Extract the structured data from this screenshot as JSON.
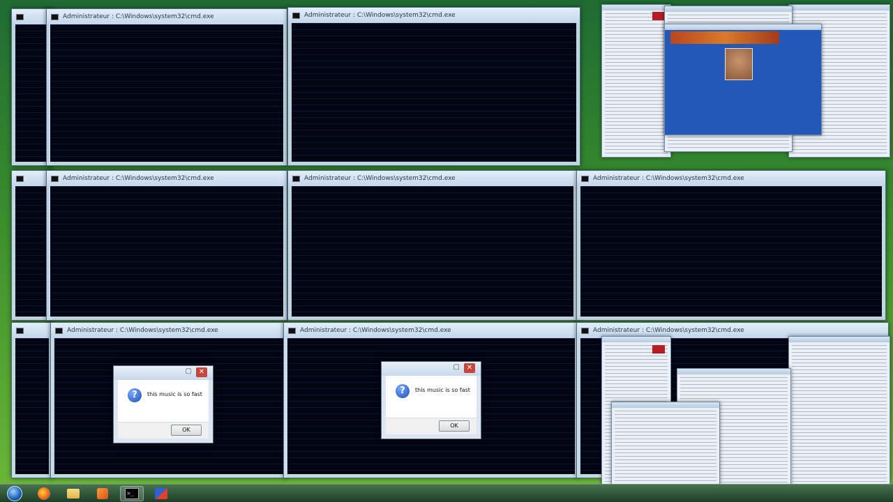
{
  "cmd_title": "Administrateur : C:\\Windows\\system32\\cmd.exe",
  "cmd_icon": "cmd-icon",
  "dialog": {
    "message": "this music is so fast",
    "ok_label": "OK",
    "icon": "question-icon"
  },
  "taskbar": {
    "items": [
      "start-orb-icon",
      "firefox-icon",
      "explorer-folder-icon",
      "media-player-icon",
      "cmd-icon",
      "app-tool-icon"
    ]
  },
  "colors": {
    "console_bg": "#020612",
    "desktop_green": "#3b8f2c",
    "window_frame": "#cddeee"
  }
}
